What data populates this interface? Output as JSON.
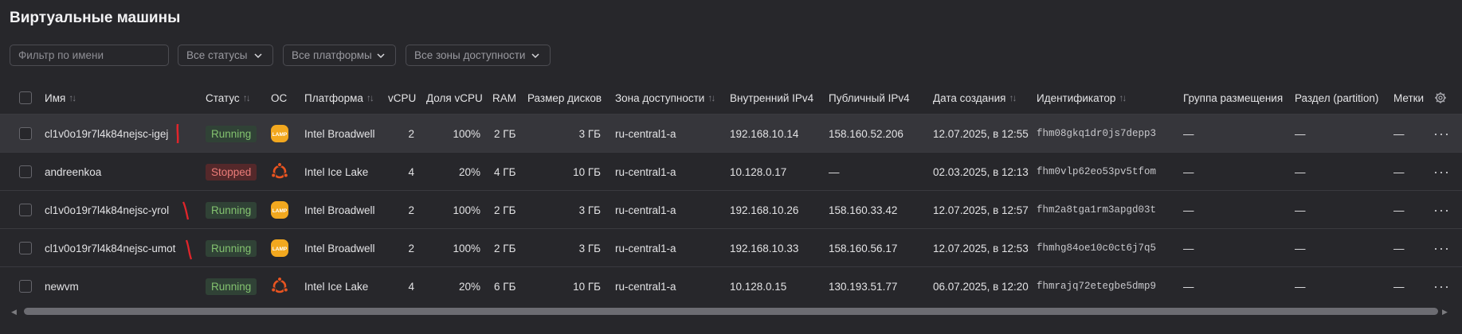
{
  "page": {
    "title": "Виртуальные машины"
  },
  "filters": {
    "name_placeholder": "Фильтр по имени",
    "status": "Все статусы",
    "platform": "Все платформы",
    "zone": "Все зоны доступности"
  },
  "columns": {
    "name": "Имя",
    "status": "Статус",
    "os": "ОС",
    "platform": "Платформа",
    "vcpu": "vCPU",
    "vcpu_share": "Доля vCPU",
    "ram": "RAM",
    "disk": "Размер дисков",
    "zone": "Зона доступности",
    "ipv4_internal": "Внутренний IPv4",
    "ipv4_public": "Публичный IPv4",
    "created": "Дата создания",
    "id": "Идентификатор",
    "placement": "Группа размещения",
    "partition": "Раздел (partition)",
    "labels": "Метки"
  },
  "rows": [
    {
      "name": "cl1v0o19r7l4k84nejsc-igej",
      "status": "Running",
      "os_icon": "lamp-icon",
      "platform": "Intel Broadwell",
      "vcpu": "2",
      "vcpu_share": "100%",
      "ram": "2 ГБ",
      "disk": "3 ГБ",
      "zone": "ru-central1-a",
      "ip_int": "192.168.10.14",
      "ip_pub": "158.160.52.206",
      "created": "12.07.2025, в 12:55",
      "id": "fhm08gkq1dr0js7depp3",
      "placement": "—",
      "partition": "—",
      "labels": "—"
    },
    {
      "name": "andreenkoa",
      "status": "Stopped",
      "os_icon": "ubuntu-icon",
      "platform": "Intel Ice Lake",
      "vcpu": "4",
      "vcpu_share": "20%",
      "ram": "4 ГБ",
      "disk": "10 ГБ",
      "zone": "ru-central1-a",
      "ip_int": "10.128.0.17",
      "ip_pub": "—",
      "created": "02.03.2025, в 12:13",
      "id": "fhm0vlp62eo53pv5tfom",
      "placement": "—",
      "partition": "—",
      "labels": "—"
    },
    {
      "name": "cl1v0o19r7l4k84nejsc-yrol",
      "status": "Running",
      "os_icon": "lamp-icon",
      "platform": "Intel Broadwell",
      "vcpu": "2",
      "vcpu_share": "100%",
      "ram": "2 ГБ",
      "disk": "3 ГБ",
      "zone": "ru-central1-a",
      "ip_int": "192.168.10.26",
      "ip_pub": "158.160.33.42",
      "created": "12.07.2025, в 12:57",
      "id": "fhm2a8tga1rm3apgd03t",
      "placement": "—",
      "partition": "—",
      "labels": "—"
    },
    {
      "name": "cl1v0o19r7l4k84nejsc-umot",
      "status": "Running",
      "os_icon": "lamp-icon",
      "platform": "Intel Broadwell",
      "vcpu": "2",
      "vcpu_share": "100%",
      "ram": "2 ГБ",
      "disk": "3 ГБ",
      "zone": "ru-central1-a",
      "ip_int": "192.168.10.33",
      "ip_pub": "158.160.56.17",
      "created": "12.07.2025, в 12:53",
      "id": "fhmhg84oe10c0ct6j7q5",
      "placement": "—",
      "partition": "—",
      "labels": "—"
    },
    {
      "name": "newvm",
      "status": "Running",
      "os_icon": "ubuntu-icon",
      "platform": "Intel Ice Lake",
      "vcpu": "4",
      "vcpu_share": "20%",
      "ram": "6 ГБ",
      "disk": "10 ГБ",
      "zone": "ru-central1-a",
      "ip_int": "10.128.0.15",
      "ip_pub": "130.193.51.77",
      "created": "06.07.2025, в 12:20",
      "id": "fhmrajq72etegbe5dmp9",
      "placement": "—",
      "partition": "—",
      "labels": "—"
    }
  ],
  "colors": {
    "background": "#27272b",
    "running_bg": "#304236",
    "running_fg": "#83c26f",
    "stopped_bg": "#54282a",
    "stopped_fg": "#ec7c79",
    "lamp": "#f2a81f",
    "ubuntu": "#e95420",
    "annotation": "#e0252b"
  }
}
